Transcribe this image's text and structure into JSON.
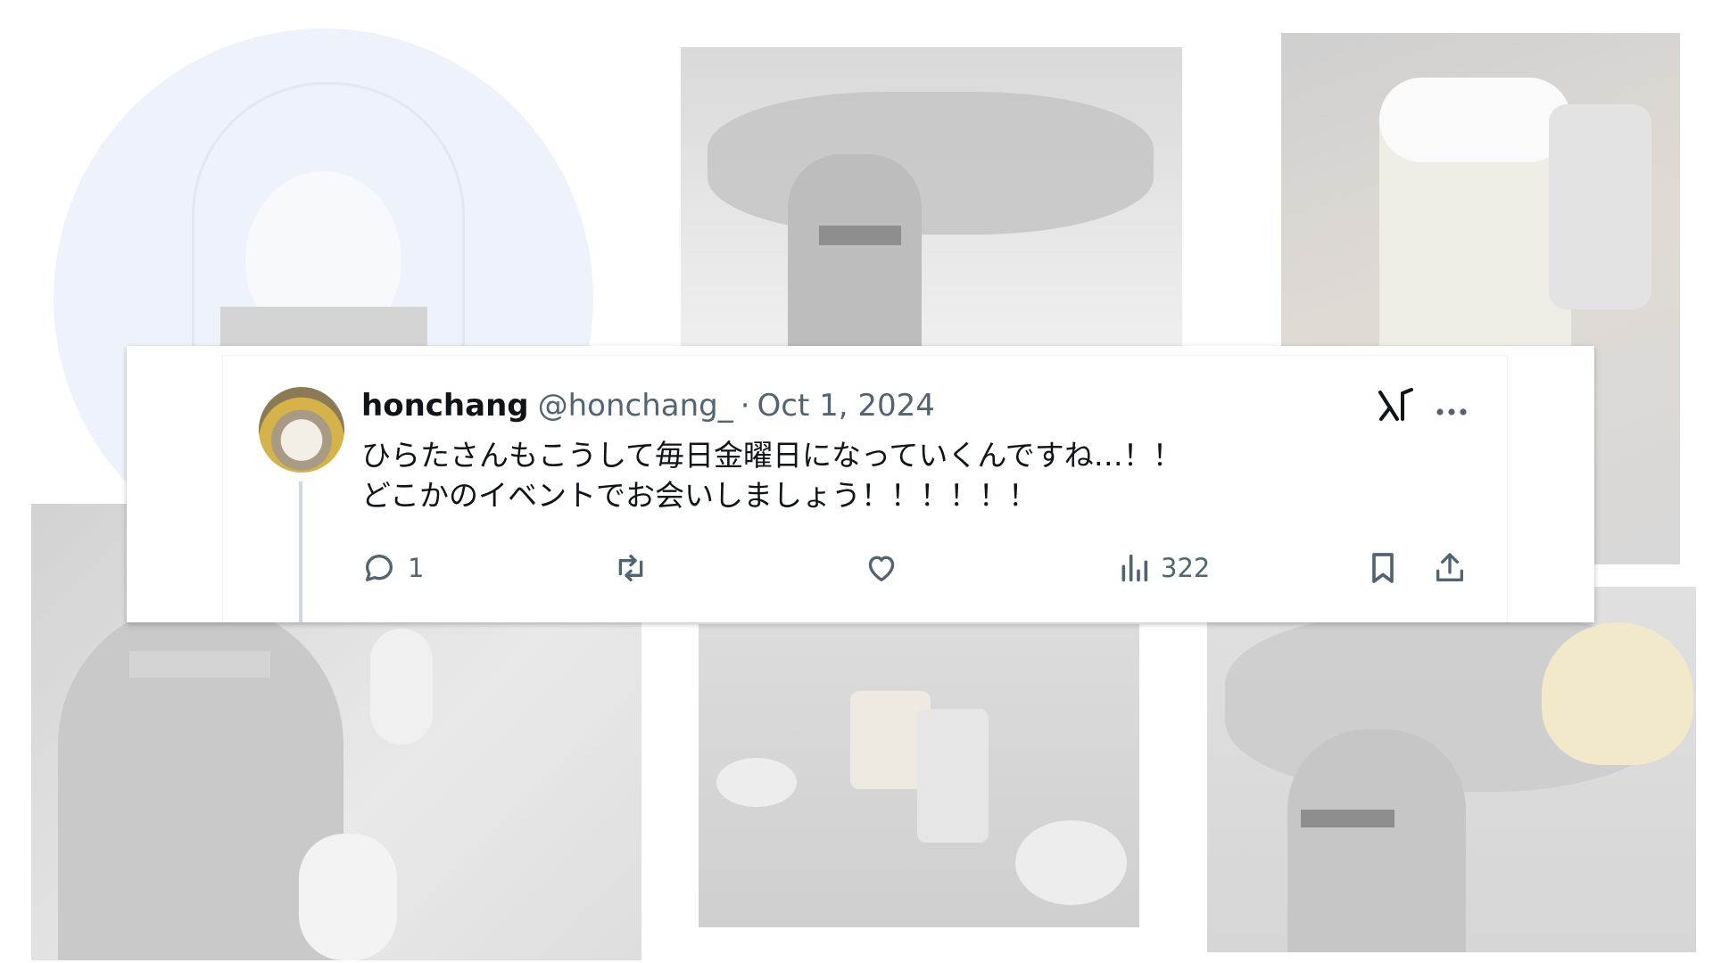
{
  "tweet": {
    "display_name": "honchang",
    "handle": "@honchang_",
    "separator": "·",
    "date": "Oct 1, 2024",
    "text_line1": "ひらたさんもこうして毎日金曜日になっていくんですね…！！",
    "text_line2": "どこかのイベントでお会いしましょう！！！！！！",
    "actions": {
      "reply_count": "1",
      "retweet_count": "",
      "like_count": "",
      "views_count": "322"
    }
  },
  "icons": {
    "reply": "speech-bubble-icon",
    "retweet": "retweet-arrows-icon",
    "like": "heart-icon",
    "views": "bar-chart-icon",
    "bookmark": "bookmark-icon",
    "share": "upload-icon",
    "grok": "grok-logo-icon",
    "more": "ellipsis-icon"
  },
  "colors": {
    "text_primary": "#0f1419",
    "text_secondary": "#536471",
    "thread_line": "#cfd9de",
    "card_background": "#ffffff"
  }
}
